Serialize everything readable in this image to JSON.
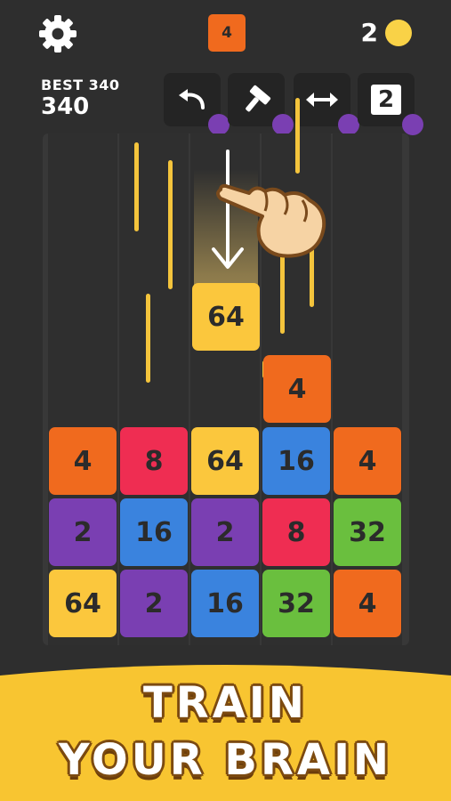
{
  "header": {
    "next_tile": "4",
    "coins": "2",
    "best_label": "BEST 340",
    "current_score": "340"
  },
  "tools": [
    {
      "name": "undo",
      "icon": "undo-arrow-icon"
    },
    {
      "name": "hammer",
      "icon": "hammer-icon"
    },
    {
      "name": "swap",
      "icon": "swap-arrows-icon"
    },
    {
      "name": "two-tile",
      "icon": "two-tile-icon",
      "label": "2"
    }
  ],
  "falling_tile": {
    "value": "64",
    "color": "#fbc73d"
  },
  "board": {
    "stack_tile": {
      "value": "4",
      "color": "#f06a1e"
    },
    "rows": [
      [
        {
          "v": "4",
          "c": "#f06a1e"
        },
        {
          "v": "8",
          "c": "#ef2d52"
        },
        {
          "v": "64",
          "c": "#fbc73d"
        },
        {
          "v": "16",
          "c": "#3a83de"
        },
        {
          "v": "4",
          "c": "#f06a1e"
        }
      ],
      [
        {
          "v": "2",
          "c": "#7a3fb2"
        },
        {
          "v": "16",
          "c": "#3a83de"
        },
        {
          "v": "2",
          "c": "#7a3fb2"
        },
        {
          "v": "8",
          "c": "#ef2d52"
        },
        {
          "v": "32",
          "c": "#6abf3e"
        }
      ],
      [
        {
          "v": "64",
          "c": "#fbc73d"
        },
        {
          "v": "2",
          "c": "#7a3fb2"
        },
        {
          "v": "16",
          "c": "#3a83de"
        },
        {
          "v": "32",
          "c": "#6abf3e"
        },
        {
          "v": "4",
          "c": "#f06a1e"
        }
      ]
    ]
  },
  "banner": {
    "line1": "TRAIN",
    "line2": "YOUR BRAIN",
    "color": "#f8c531"
  }
}
